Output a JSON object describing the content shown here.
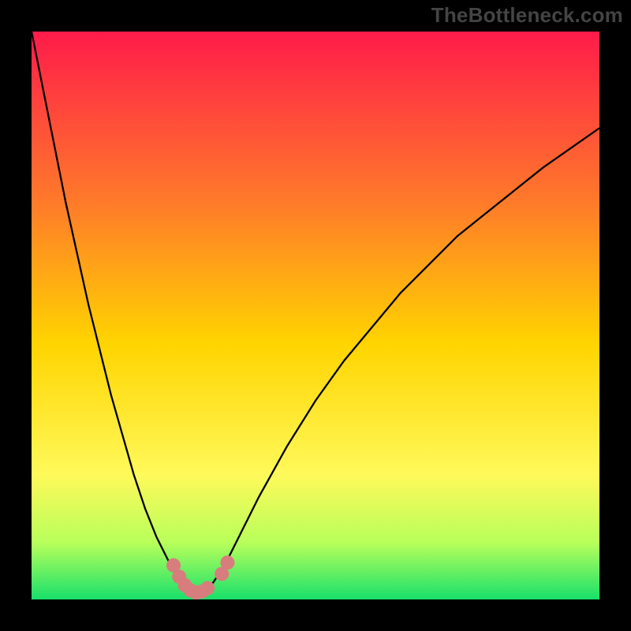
{
  "watermark": "TheBottleneck.com",
  "colors": {
    "bg": "#000000",
    "grad_top": "#ff1b4a",
    "grad_mid_upper": "#ff7a2a",
    "grad_mid": "#ffd400",
    "grad_lower": "#fff95a",
    "grad_green_light": "#b8ff5a",
    "grad_green": "#18e06b",
    "curve": "#000000",
    "marker": "#d77d7d"
  },
  "chart_data": {
    "type": "line",
    "title": "",
    "xlabel": "",
    "ylabel": "",
    "xlim": [
      0,
      100
    ],
    "ylim": [
      0,
      100
    ],
    "x": [
      0,
      2,
      4,
      6,
      8,
      10,
      12,
      14,
      16,
      18,
      20,
      22,
      24,
      26,
      27,
      28,
      29,
      30,
      32,
      34,
      36,
      40,
      45,
      50,
      55,
      60,
      65,
      70,
      75,
      80,
      85,
      90,
      95,
      100
    ],
    "values": [
      100,
      90,
      80,
      70,
      61,
      52,
      44,
      36,
      29,
      22,
      16,
      11,
      7,
      3.5,
      2,
      1.3,
      1,
      1.3,
      3,
      6,
      10,
      18,
      27,
      35,
      42,
      48,
      54,
      59,
      64,
      68,
      72,
      76,
      79.5,
      83
    ],
    "min_x": 29,
    "markers": [
      {
        "x": 25.0,
        "y": 6.0
      },
      {
        "x": 26.0,
        "y": 4.0
      },
      {
        "x": 27.0,
        "y": 2.5
      },
      {
        "x": 28.0,
        "y": 1.6
      },
      {
        "x": 29.0,
        "y": 1.2
      },
      {
        "x": 30.0,
        "y": 1.4
      },
      {
        "x": 31.0,
        "y": 2.0
      },
      {
        "x": 33.5,
        "y": 4.5
      },
      {
        "x": 34.5,
        "y": 6.5
      }
    ],
    "marker_radius_px": 9
  }
}
